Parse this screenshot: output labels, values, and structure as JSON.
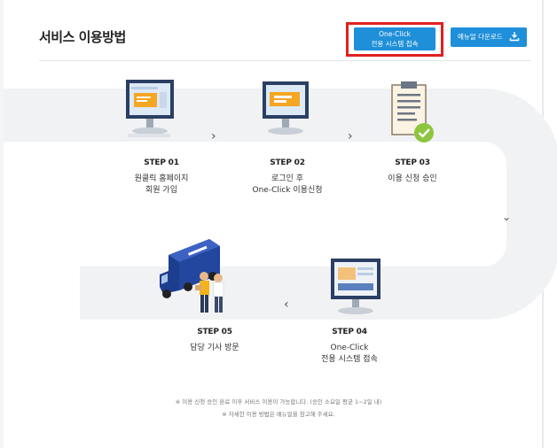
{
  "header": {
    "title": "서비스 이용방법",
    "oneclick_button_line1": "One-Click",
    "oneclick_button_line2": "전용 시스템 접속",
    "manual_button": "메뉴얼 다운로드"
  },
  "steps": [
    {
      "label": "STEP 01",
      "desc_line1": "원클릭 홈페이지",
      "desc_line2": "회원 가입"
    },
    {
      "label": "STEP 02",
      "desc_line1": "로그인 후",
      "desc_line2": "One-Click 이용신청"
    },
    {
      "label": "STEP 03",
      "desc_line1": "이용 신청 승인",
      "desc_line2": ""
    },
    {
      "label": "STEP 04",
      "desc_line1": "One-Click",
      "desc_line2": "전용 시스템 접속"
    },
    {
      "label": "STEP 05",
      "desc_line1": "담당 기사 방문",
      "desc_line2": ""
    }
  ],
  "notes": [
    "※ 이용 신청 승인 완료 이후 서비스 이용이 가능합니다. (승인 소요일 평균 1~2일 내)",
    "※ 자세한 이용 방법은 매뉴얼을 참고해 주세요."
  ],
  "colors": {
    "accent": "#1f8fd9",
    "highlight": "#e0211f",
    "path": "#f1f2f4",
    "side_tab": "#2f4475"
  },
  "icons": [
    "download-icon",
    "chevron-right-icon",
    "chevron-down-icon",
    "chevron-left-icon",
    "checkmark-icon",
    "monitor-icon",
    "clipboard-icon",
    "truck-icon"
  ]
}
